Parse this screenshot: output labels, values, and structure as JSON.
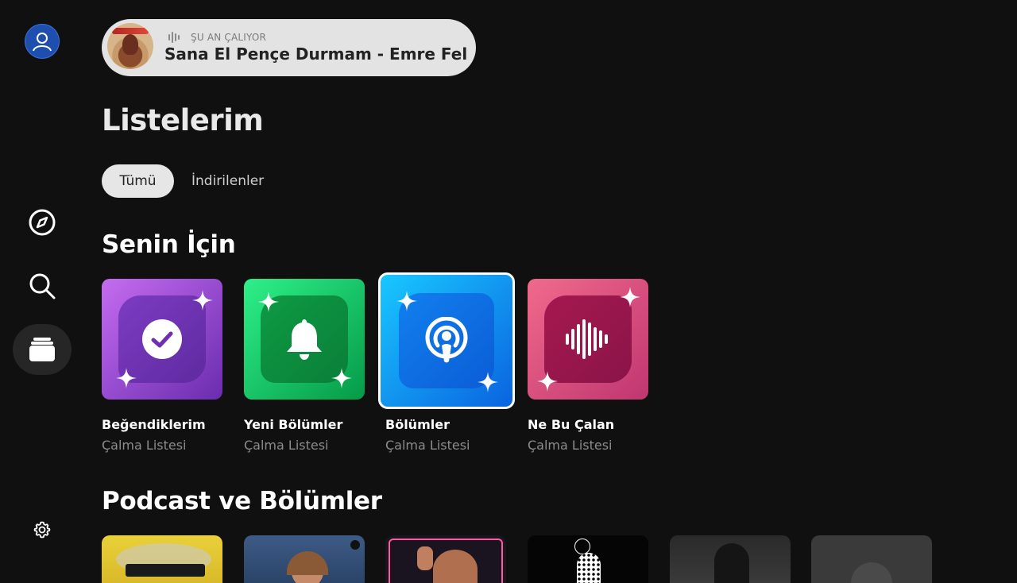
{
  "now_playing": {
    "label": "ŞU AN ÇALIYOR",
    "title": "Sana El Pençe Durmam - Emre Fel"
  },
  "page": {
    "title": "Listelerim"
  },
  "filters": [
    {
      "label": "Tümü",
      "active": true
    },
    {
      "label": "İndirilenler",
      "active": false
    }
  ],
  "sections": {
    "for_you": "Senin İçin",
    "podcasts": "Podcast ve Bölümler"
  },
  "playlists": [
    {
      "title": "Beğendiklerim",
      "subtitle": "Çalma Listesi",
      "icon": "check-circle-icon",
      "colors": [
        "#b45ce6",
        "#6f2fb4"
      ]
    },
    {
      "title": "Yeni Bölümler",
      "subtitle": "Çalma Listesi",
      "icon": "bell-icon",
      "colors": [
        "#1fd67a",
        "#0a8a3e"
      ]
    },
    {
      "title": "Bölümler",
      "subtitle": "Çalma Listesi",
      "icon": "podcast-icon",
      "colors": [
        "#19c6ff",
        "#0a63e0"
      ],
      "selected": true
    },
    {
      "title": "Ne Bu Çalan",
      "subtitle": "Çalma Listesi",
      "icon": "soundwave-icon",
      "colors": [
        "#ef6585",
        "#a0194f"
      ]
    }
  ],
  "podcast_tiles": [
    {
      "icon": "podcast-cover"
    },
    {
      "icon": "podcast-cover"
    },
    {
      "icon": "podcast-cover"
    },
    {
      "icon": "podcast-cover"
    },
    {
      "icon": "podcast-cover"
    },
    {
      "icon": "podcast-cover"
    }
  ],
  "sidebar": [
    {
      "icon": "user-avatar-icon"
    },
    {
      "icon": "compass-icon"
    },
    {
      "icon": "search-icon"
    },
    {
      "icon": "library-icon",
      "active": true
    },
    {
      "icon": "gear-icon"
    }
  ]
}
